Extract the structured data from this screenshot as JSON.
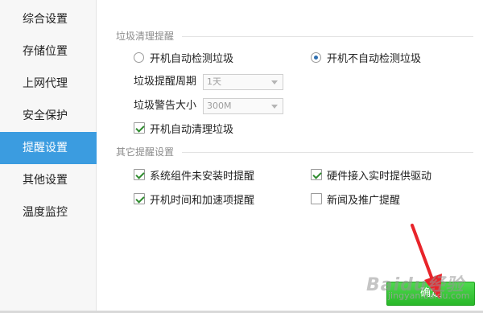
{
  "sidebar": {
    "items": [
      {
        "label": "综合设置"
      },
      {
        "label": "存储位置"
      },
      {
        "label": "上网代理"
      },
      {
        "label": "安全保护"
      },
      {
        "label": "提醒设置"
      },
      {
        "label": "其他设置"
      },
      {
        "label": "温度监控"
      }
    ],
    "active_index": 4
  },
  "trash_reminder": {
    "title": "垃圾清理提醒",
    "radio_auto": {
      "label": "开机自动检测垃圾",
      "checked": false
    },
    "radio_no_auto": {
      "label": "开机不自动检测垃圾",
      "checked": true
    },
    "period_label": "垃圾提醒周期",
    "period_value": "1天",
    "size_label": "垃圾警告大小",
    "size_value": "300M",
    "auto_clean": {
      "label": "开机自动清理垃圾",
      "checked": true
    }
  },
  "other_reminder": {
    "title": "其它提醒设置",
    "options": [
      {
        "label": "系统组件未安装时提醒",
        "checked": true
      },
      {
        "label": "硬件接入实时提供驱动",
        "checked": true
      },
      {
        "label": "开机时间和加速项提醒",
        "checked": true
      },
      {
        "label": "新闻及推广提醒",
        "checked": false
      }
    ]
  },
  "footer": {
    "confirm_label": "确定"
  },
  "watermark": {
    "brand": "Baidu经验",
    "url": "jingyan.baidu.com"
  },
  "colors": {
    "sidebar_active": "#3b9ce0",
    "confirm_button": "#2fbd2f",
    "arrow": "#e8242a"
  }
}
